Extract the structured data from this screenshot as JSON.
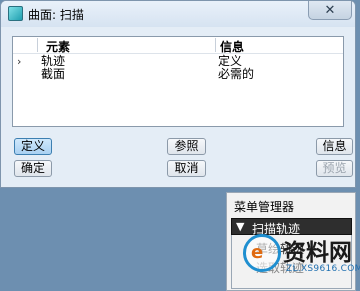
{
  "dialog": {
    "title": "曲面: 扫描",
    "close_symbol": "✕",
    "columns": {
      "element": "元素",
      "info": "信息"
    },
    "rows": [
      {
        "expander": "›",
        "element": "轨迹",
        "info": "定义"
      },
      {
        "expander": "",
        "element": "截面",
        "info": "必需的"
      }
    ],
    "buttons": {
      "define": "定义",
      "reference": "参照",
      "info": "信息",
      "ok": "确定",
      "cancel": "取消",
      "preview": "预览"
    }
  },
  "menu_manager": {
    "title": "菜单管理器",
    "section": "扫描轨迹",
    "section_icon": "triangle-down-icon",
    "items": [
      "草绘轨迹",
      "选取轨迹"
    ]
  },
  "watermark": {
    "logo_letter": "e",
    "text": "资料网",
    "url": "ZL.XS9616.COM"
  },
  "colors": {
    "desktop": "#6d8fb0",
    "dialog_bg": "#e4edf6",
    "active_button": "#a9d1f2",
    "menu_section_bg": "#2e2e2e"
  }
}
